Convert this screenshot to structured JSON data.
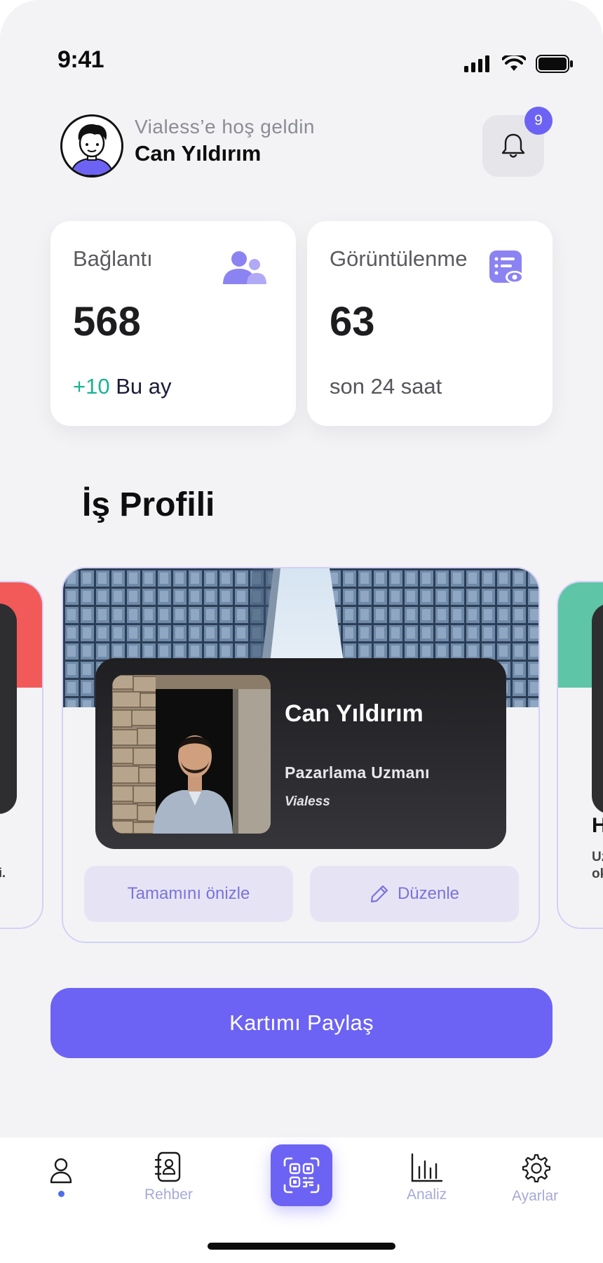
{
  "status_bar": {
    "time": "9:41"
  },
  "header": {
    "welcome": "Vialess’e hoş geldin",
    "username": "Can Yıldırım",
    "notification_count": "9"
  },
  "stats": {
    "connections": {
      "label": "Bağlantı",
      "value": "568",
      "delta": "+10",
      "period": "Bu ay"
    },
    "views": {
      "label": "Görüntülenme",
      "value": "63",
      "period": "son 24 saat"
    }
  },
  "section": {
    "title": "İş Profili"
  },
  "profile_card": {
    "name": "Can Yıldırım",
    "title": "Pazarlama Uzmanı",
    "company": "Vialess",
    "preview_label": "Tamamını önizle",
    "edit_label": "Düzenle"
  },
  "side_cards": {
    "left_snippet": "i.",
    "right_heading": "H",
    "right_snippet_1": "Uz",
    "right_snippet_2": "ok"
  },
  "share": {
    "label": "Kartımı Paylaş"
  },
  "nav": {
    "items": [
      {
        "label": "",
        "icon": "person-icon",
        "active": true
      },
      {
        "label": "Rehber",
        "icon": "contacts-book-icon"
      },
      {
        "label": "",
        "icon": "qr-code-icon"
      },
      {
        "label": "Analiz",
        "icon": "bar-chart-icon"
      },
      {
        "label": "Ayarlar",
        "icon": "gear-icon"
      }
    ]
  },
  "colors": {
    "accent": "#6c63f4",
    "positive": "#1ab394",
    "badge": "#6c63f4",
    "side_red": "#f25a5a",
    "side_green": "#5ec5a6"
  }
}
